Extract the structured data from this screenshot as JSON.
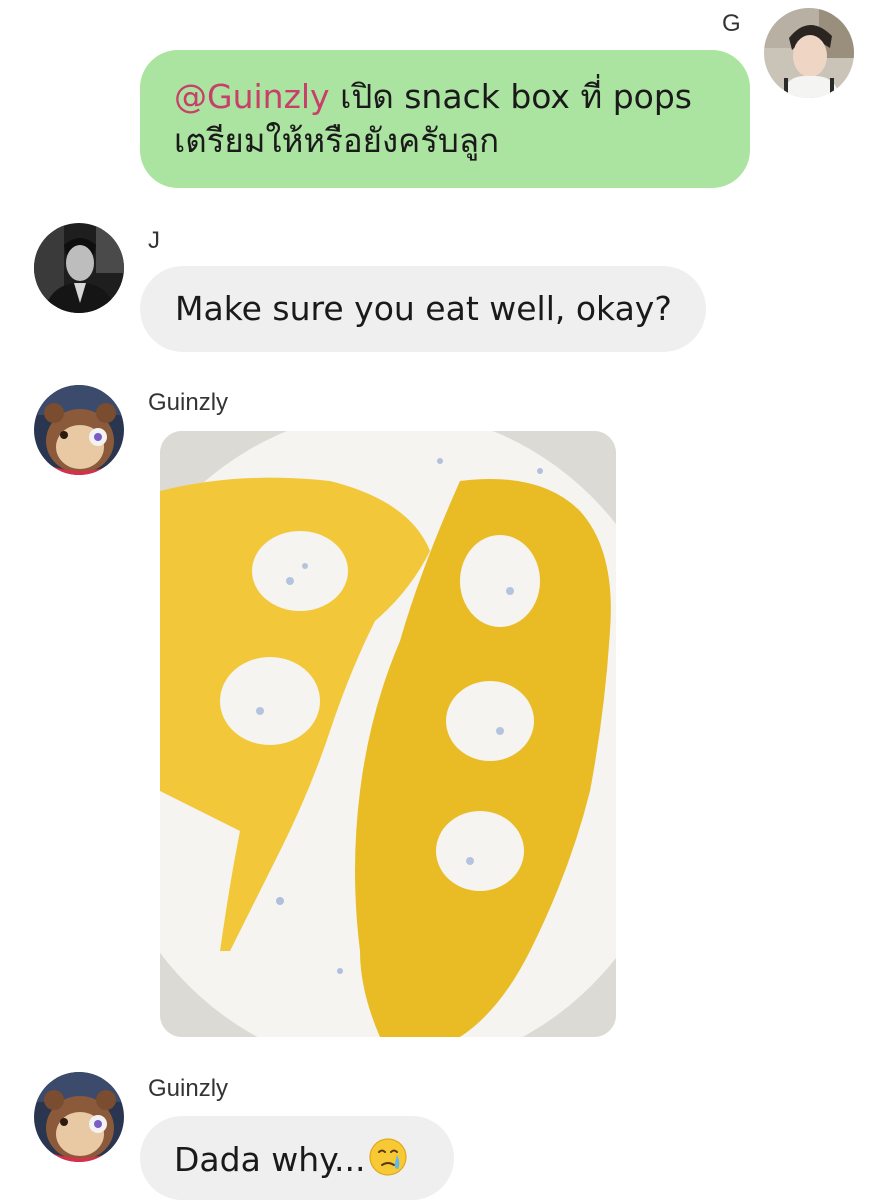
{
  "messages": [
    {
      "sender": "G",
      "direction": "outgoing",
      "mention": "@Guinzly",
      "text": "เปิด snack box ที่ pops",
      "text_line2": "เตรียมให้หรือยังครับลูก"
    },
    {
      "sender": "J",
      "direction": "incoming",
      "text": "Make sure you eat well, okay?"
    },
    {
      "sender": "Guinzly",
      "direction": "incoming",
      "attachment": "photo"
    },
    {
      "sender": "Guinzly",
      "direction": "incoming",
      "text": "Dada why...",
      "emoji": "crying-face-emoji"
    }
  ],
  "colors": {
    "outgoing_bubble": "#abe3a0",
    "incoming_bubble": "#efeff0",
    "mention": "#c8406a",
    "background": "#ffffff"
  }
}
